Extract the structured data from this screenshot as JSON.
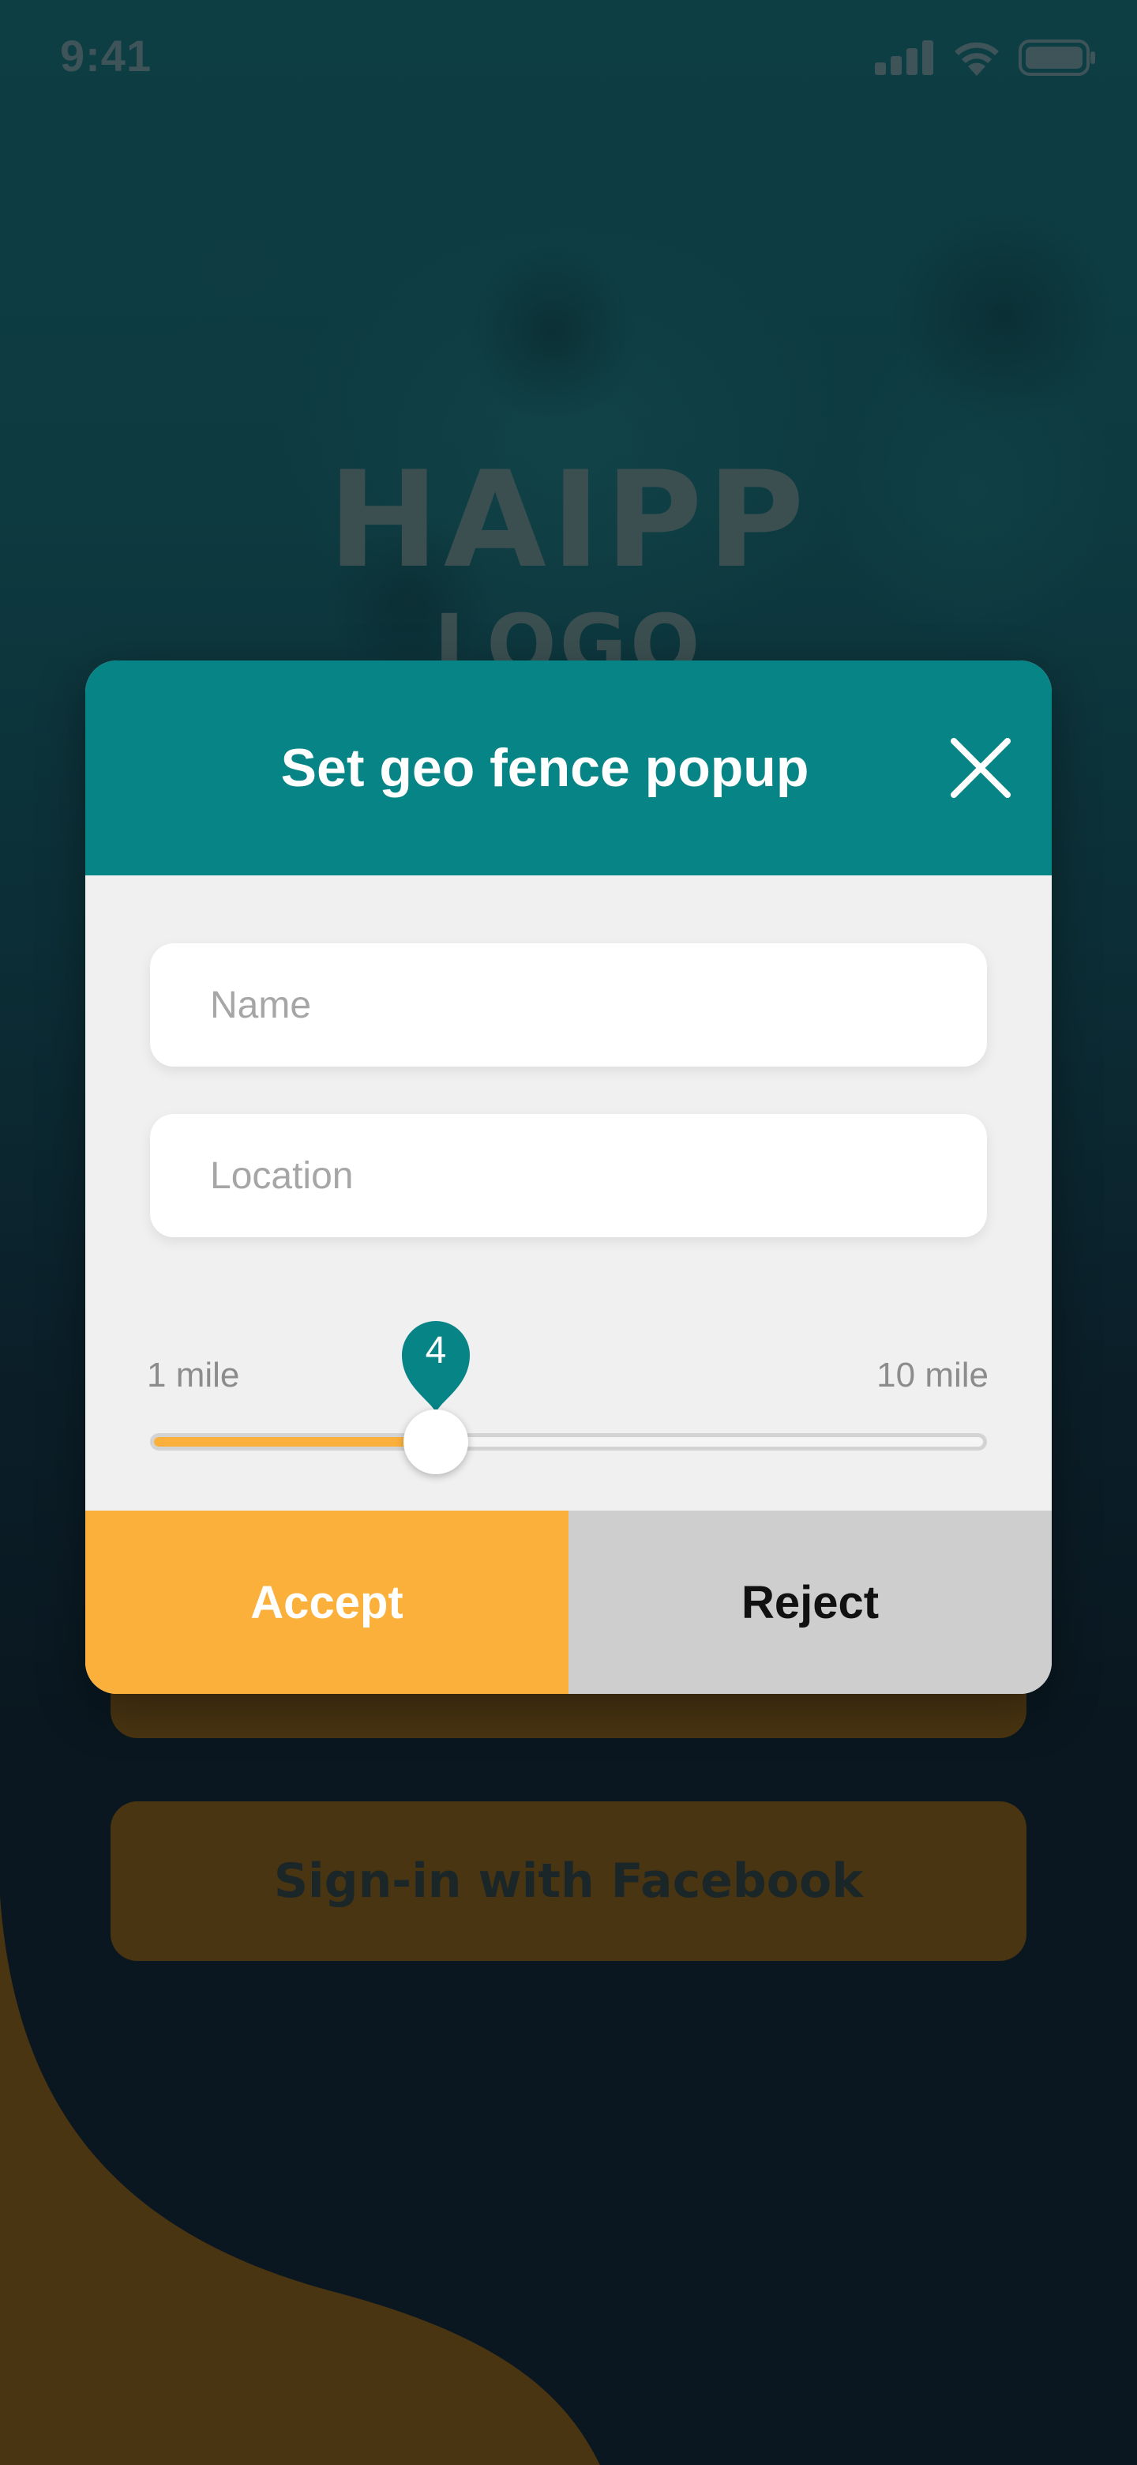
{
  "status_bar": {
    "time": "9:41",
    "icons": [
      "cellular-signal-icon",
      "wifi-icon",
      "battery-icon"
    ]
  },
  "background": {
    "logo_title": "HAIPP",
    "logo_subtitle": "LOGO",
    "buttons": [
      {
        "label": ""
      },
      {
        "label": "Sign-in with Facebook"
      }
    ]
  },
  "modal": {
    "title": "Set geo fence popup",
    "close_icon": "close-icon",
    "name_field": {
      "placeholder": "Name",
      "value": ""
    },
    "location_field": {
      "placeholder": "Location",
      "value": ""
    },
    "range": {
      "min_label": "1 mile",
      "max_label": "10 mile",
      "min": 1,
      "max": 10,
      "value": 4,
      "value_label": "4"
    },
    "accept_label": "Accept",
    "reject_label": "Reject"
  },
  "colors": {
    "header": "#078486",
    "accept": "#fbb03b",
    "reject": "#cecece",
    "slider_fill": "#fbb03b",
    "bubble": "#078486"
  }
}
